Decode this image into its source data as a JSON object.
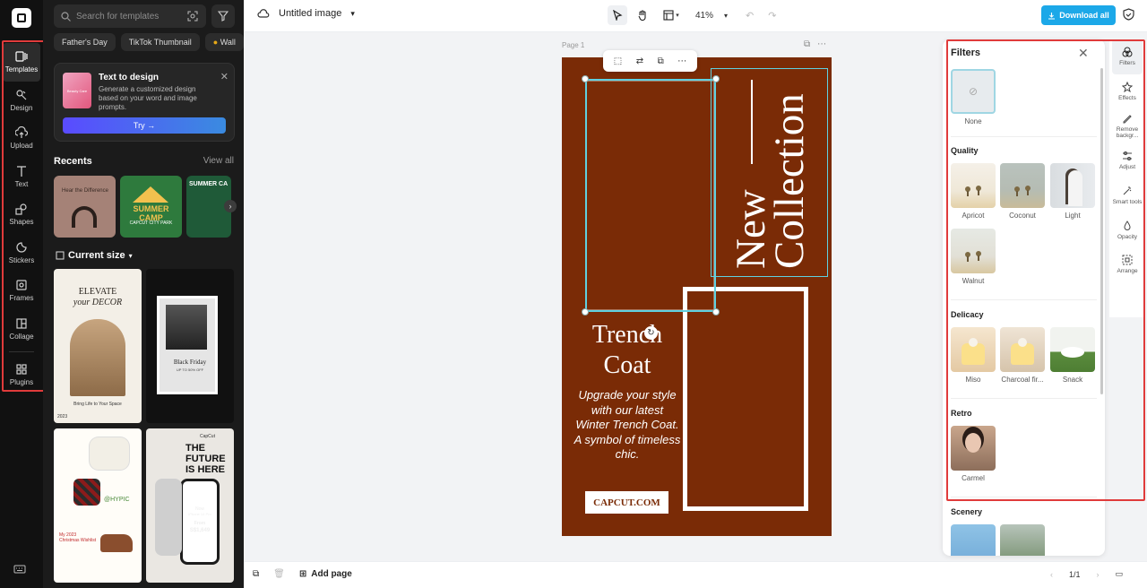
{
  "rail": {
    "items": [
      {
        "label": "Templates",
        "icon": "templates-icon"
      },
      {
        "label": "Design",
        "icon": "design-icon"
      },
      {
        "label": "Upload",
        "icon": "upload-icon"
      },
      {
        "label": "Text",
        "icon": "text-icon"
      },
      {
        "label": "Shapes",
        "icon": "shapes-icon"
      },
      {
        "label": "Stickers",
        "icon": "stickers-icon"
      },
      {
        "label": "Frames",
        "icon": "frames-icon"
      },
      {
        "label": "Collage",
        "icon": "collage-icon"
      },
      {
        "label": "Plugins",
        "icon": "plugins-icon"
      }
    ]
  },
  "panel": {
    "search_placeholder": "Search for templates",
    "chips": [
      "Father's Day",
      "TikTok Thumbnail",
      "Wall"
    ],
    "promo": {
      "thumb_text": "Beauty Care",
      "title": "Text to design",
      "description": "Generate a customized design based on your word and image prompts.",
      "button": "Try →"
    },
    "recents_title": "Recents",
    "view_all": "View all",
    "recents": [
      {
        "text": "Hear the Difference"
      },
      {
        "text": "SUMMER CAMP",
        "sub": "CAPCUT CITY PARK"
      },
      {
        "text": "SUMMER CA"
      }
    ],
    "size_title": "Current size",
    "templates": [
      {
        "title_a": "ELEVATE",
        "title_b": "your DECOR",
        "caption": "Bring Life to Your Space",
        "year": "2023"
      },
      {
        "title_a": "Black Friday",
        "caption": "UP TO 50% OFF"
      },
      {
        "title_a": "@HYPIC",
        "caption": "My 2023 Christmas Wishlist"
      },
      {
        "title_a": "THE",
        "title_b": "FUTURE",
        "title_c": "IS HERE",
        "phone_line1": "Now",
        "phone_line2": "iPhone 14 Pro",
        "phone_line3": "From",
        "phone_line4": "S$1,649",
        "brand": "CapCut"
      }
    ]
  },
  "topbar": {
    "doc_title": "Untitled image",
    "zoom": "41%",
    "download": "Download all"
  },
  "canvas": {
    "page_label": "Page 1",
    "new_line1": "New",
    "new_line2": "Collection",
    "trench": "Trench Coat",
    "body": "Upgrade your style with our latest Winter Trench Coat. A symbol of timeless chic.",
    "cta": "CAPCUT.COM",
    "artboard_color": "#7a2b06"
  },
  "filters": {
    "title": "Filters",
    "none_label": "None",
    "sections": [
      {
        "name": "Quality",
        "items": [
          "Apricot",
          "Coconut",
          "Light",
          "Walnut"
        ]
      },
      {
        "name": "Delicacy",
        "items": [
          "Miso",
          "Charcoal fir...",
          "Snack"
        ]
      },
      {
        "name": "Retro",
        "items": [
          "Carmel"
        ]
      },
      {
        "name": "Scenery",
        "items": []
      }
    ]
  },
  "rrail": {
    "items": [
      {
        "label": "Filters"
      },
      {
        "label": "Effects"
      },
      {
        "label": "Remove backgr..."
      },
      {
        "label": "Adjust"
      },
      {
        "label": "Smart tools"
      },
      {
        "label": "Opacity"
      },
      {
        "label": "Arrange"
      }
    ]
  },
  "bottombar": {
    "add_page": "Add page",
    "pagination": "1/1"
  },
  "colors": {
    "accent": "#1ca8e8",
    "highlight": "#e03b3b",
    "selection": "#5fd0e0"
  }
}
